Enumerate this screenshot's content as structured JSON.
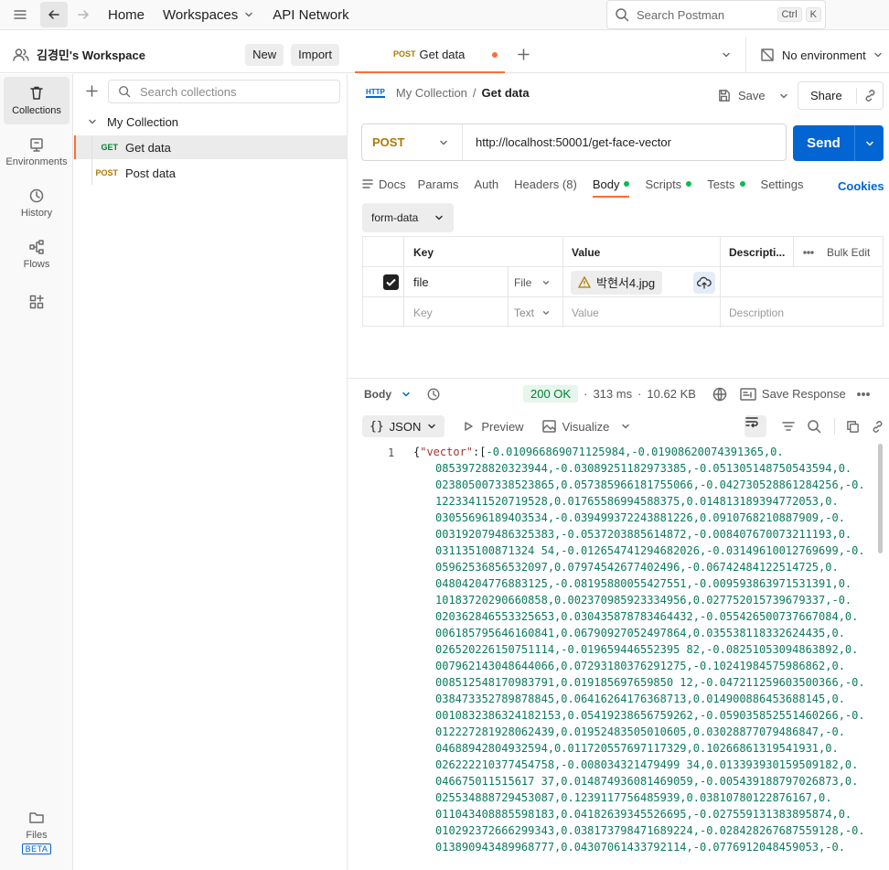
{
  "topbar": {
    "home": "Home",
    "workspaces": "Workspaces",
    "api_network": "API Network",
    "search_placeholder": "Search Postman",
    "shortcut_ctrl": "Ctrl",
    "shortcut_k": "K"
  },
  "workspace": {
    "name": "김경민's Workspace",
    "new_label": "New",
    "import_label": "Import"
  },
  "rail": {
    "collections": "Collections",
    "environments": "Environments",
    "history": "History",
    "flows": "Flows",
    "files": "Files",
    "beta": "BETA"
  },
  "sidebar": {
    "search_placeholder": "Search collections",
    "collection_name": "My Collection",
    "items": [
      {
        "method": "GET",
        "name": "Get data"
      },
      {
        "method": "POST",
        "name": "Post data"
      }
    ]
  },
  "tab": {
    "method": "POST",
    "name": "Get data"
  },
  "environment": {
    "label": "No environment"
  },
  "breadcrumb": {
    "collection": "My Collection",
    "separator": "/",
    "request": "Get data",
    "save": "Save",
    "share": "Share"
  },
  "request": {
    "method": "POST",
    "url": "http://localhost:50001/get-face-vector",
    "send": "Send",
    "tabs": [
      {
        "label": "Docs"
      },
      {
        "label": "Params"
      },
      {
        "label": "Auth"
      },
      {
        "label": "Headers (8)"
      },
      {
        "label": "Body"
      },
      {
        "label": "Scripts"
      },
      {
        "label": "Tests"
      },
      {
        "label": "Settings"
      }
    ],
    "cookies": "Cookies",
    "body_type": "form-data"
  },
  "params_table": {
    "headers": {
      "key": "Key",
      "value": "Value",
      "description": "Descripti...",
      "bulk_edit": "Bulk Edit"
    },
    "rows": [
      {
        "key": "file",
        "type": "File",
        "value": "박현서4.jpg",
        "description": ""
      },
      {
        "key": "Key",
        "type": "Text",
        "value": "Value",
        "description": "Description"
      }
    ]
  },
  "response": {
    "label": "Body",
    "status": "200 OK",
    "time": "313 ms",
    "size": "10.62 KB",
    "save_response": "Save Response",
    "format": "JSON",
    "preview": "Preview",
    "visualize": "Visualize",
    "line_number": "1",
    "json_key": "\"vector\"",
    "lines": [
      "-0.010966869071125984,-0.01908620074391365,0.",
      "08539728820323944,-0.03089251182973385,-0.051305148750543594,0.",
      "023805007338523865,0.057385966181755066,-0.042730528861284256,-0.",
      "12233411520719528,0.01765586994588375,0.014813189394772053,0.",
      "030556961894O3534,-0.039499372243881226,0.0910768210887909,-0.",
      "003192079486325383,-0.0537203885614872,-0.008407670073211193,0.",
      "031135100871324 54,-0.012654741294682026,-0.03149610012769699,-0.",
      "05962536856532097,0.07974542677402496,-0.06742484122514725,0.",
      "04804204776883125,-0.08195880055427551,-0.009593863971531391,0.",
      "10183720290660858,0.002370985923334956,0.027752015739679337,-0.",
      "020362846553325653,0.030435878783464432,-0.055426500737667084,0.",
      "006185795646160841,0.06790927052497864,0.035538118332624435,0.",
      "026520226150751114,-0.019659446552395 82,-0.08251053094863892,0.",
      "007962143048644066,0.07293180376291275,-0.10241984575986862,0.",
      "008512548170983791,0.019185697659850 12,-0.047211259603500366,-0.",
      "038473352789878845,0.06416264176368713,0.014900886453688145,0.",
      "0010832386324182153,0.05419238656759262,-0.059035852551460266,-0.",
      "012227281928062439,0.01952483505010605,0.03028877079486847,-0.",
      "04688942804932594,0.011720557697117329,0.10266861319541931,0.",
      "026222210377454758,-0.008034321479499 34,0.013393930159509182,0.",
      "046675011515617 37,0.014874936081469059,-0.005439188797026873,0.",
      "025534888729453087,0.1239117756485939,0.03810780122876167,0.",
      "011043408885598183,0.04182639345526695,-0.027559131383895874,0.",
      "010292372666299343,0.038173798471689224,-0.028428267687559128,-0.",
      "013890943489968777,0.04307061433792114,-0.0776912048459053,-0."
    ]
  }
}
